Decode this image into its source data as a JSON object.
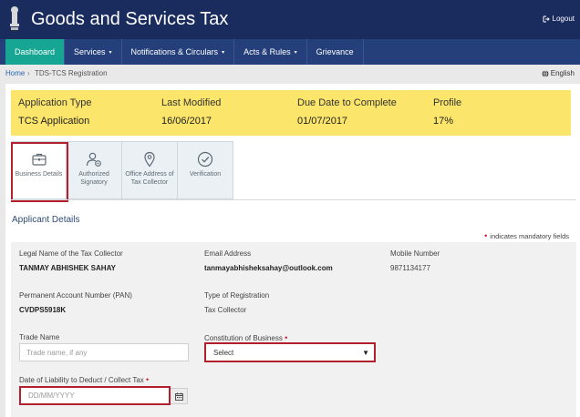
{
  "header": {
    "title": "Goods and Services Tax",
    "logout_label": "Logout",
    "colors": {
      "header_bg": "#1a2b5e",
      "nav_bg": "#243f7a",
      "active_tab": "#17a693"
    }
  },
  "nav": {
    "items": [
      {
        "label": "Dashboard",
        "has_caret": false
      },
      {
        "label": "Services",
        "has_caret": true
      },
      {
        "label": "Notifications & Circulars",
        "has_caret": true
      },
      {
        "label": "Acts & Rules",
        "has_caret": true
      },
      {
        "label": "Grievance",
        "has_caret": false
      }
    ],
    "caret": "▾"
  },
  "breadcrumb": {
    "home": "Home",
    "separator": "›",
    "current": "TDS-TCS Registration"
  },
  "language": {
    "label": "English",
    "icon": "globe-icon"
  },
  "application": {
    "labels": [
      "Application Type",
      "Last Modified",
      "Due Date to Complete",
      "Profile"
    ],
    "values": [
      "TCS Application",
      "16/06/2017",
      "01/07/2017",
      "17%"
    ],
    "banner_color": "#fbe56b"
  },
  "tabs": [
    {
      "label": "Business Details",
      "icon": "briefcase-icon",
      "selected": true
    },
    {
      "label": "Authorized Signatory",
      "icon": "user-settings-icon",
      "selected": false
    },
    {
      "label": "Office Address of Tax Collector",
      "icon": "location-pin-icon",
      "selected": false
    },
    {
      "label": "Verification",
      "icon": "check-circle-icon",
      "selected": false
    }
  ],
  "section": {
    "title": "Applicant Details",
    "mandatory_marker": "•",
    "mandatory_note": "indicates mandatory fields"
  },
  "fields": {
    "legal_name": {
      "label": "Legal Name of the Tax Collector",
      "value": "TANMAY ABHISHEK SAHAY"
    },
    "email": {
      "label": "Email Address",
      "value": "tanmayabhisheksahay@outlook.com"
    },
    "mobile": {
      "label": "Mobile Number",
      "value": "9871134177"
    },
    "pan": {
      "label": "Permanent Account Number (PAN)",
      "value": "CVDPS5918K"
    },
    "registration_type": {
      "label": "Type of Registration",
      "value": "Tax Collector"
    },
    "trade_name": {
      "label": "Trade Name",
      "placeholder": "Trade name, if any"
    },
    "constitution": {
      "label": "Constitution of Business",
      "required_marker": "•",
      "selected": "Select"
    },
    "liability_date": {
      "label": "Date of Liability to Deduct / Collect Tax",
      "required_marker": "•",
      "placeholder": "DD/MM/YYYY"
    }
  },
  "highlight_color": "#b2202e"
}
